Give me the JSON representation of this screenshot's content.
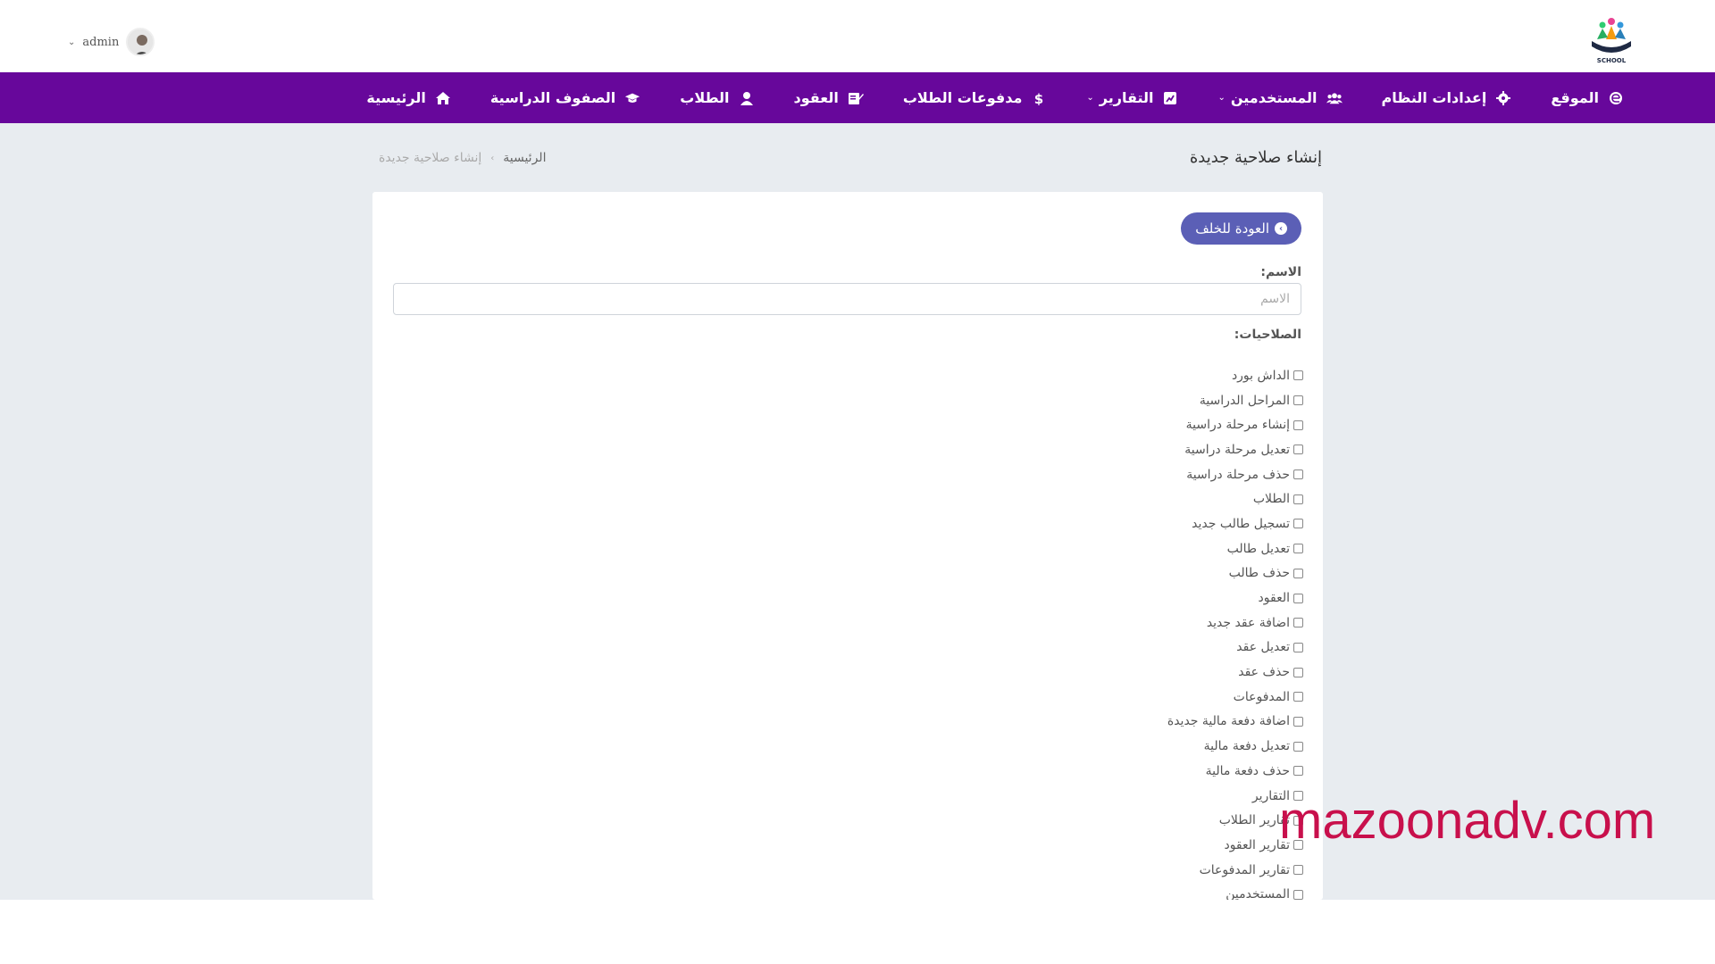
{
  "header": {
    "user_name": "admin",
    "user_caret": "⌄",
    "logo_caption": "SCHOOL"
  },
  "nav": {
    "items": [
      {
        "label": "الرئيسية",
        "icon": "home-icon"
      },
      {
        "label": "الصفوف الدراسية",
        "icon": "graduation-cap-icon"
      },
      {
        "label": "الطلاب",
        "icon": "student-icon"
      },
      {
        "label": "العقود",
        "icon": "contract-icon"
      },
      {
        "label": "مدفوعات الطلاب",
        "icon": "dollar-icon"
      },
      {
        "label": "التقارير",
        "icon": "report-icon",
        "caret": "⌄"
      },
      {
        "label": "المستخدمين",
        "icon": "users-icon",
        "caret": "⌄"
      },
      {
        "label": "إعدادات النظام",
        "icon": "gear-icon"
      },
      {
        "label": "الموقع",
        "icon": "browser-icon"
      }
    ]
  },
  "page": {
    "title": "إنشاء صلاحية جديدة",
    "breadcrumb": {
      "home": "الرئيسية",
      "separator": "›",
      "current": "إنشاء صلاحية جديدة"
    }
  },
  "form": {
    "back_label": "العودة للخلف",
    "name_label": "الاسم:",
    "name_placeholder": "الاسم",
    "name_value": "",
    "permissions_label": "الصلاحيات:",
    "permissions": [
      "الداش بورد",
      "المراحل الدراسية",
      "إنشاء مرحلة دراسية",
      "تعديل مرحلة دراسية",
      "حذف مرحلة دراسية",
      "الطلاب",
      "تسجيل طالب جديد",
      "تعديل طالب",
      "حذف طالب",
      "العقود",
      "اضافة عقد جديد",
      "تعديل عقد",
      "حذف عقد",
      "المدفوعات",
      "اضافة دفعة مالية جديدة",
      "تعديل دفعة مالية",
      "حذف دفعة مالية",
      "التقارير",
      "تقارير الطلاب",
      "تقارير العقود",
      "تقارير المدفوعات",
      "المستخدمين"
    ]
  },
  "watermark": "mazoonadv.com",
  "colors": {
    "navbar": "#67079b",
    "page_bg": "#e8ecf0",
    "button": "#5b5fb6",
    "watermark": "#c8104c"
  }
}
